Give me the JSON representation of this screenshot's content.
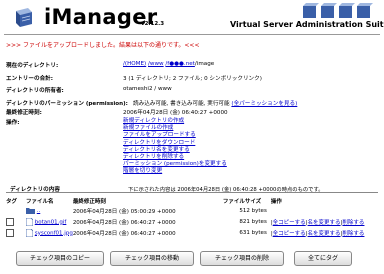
{
  "header": {
    "title": "iManager",
    "version": "v2.12.3",
    "suite": "Virtual Server Administration Suite"
  },
  "notice": ">>> ファイルをアップロードしました。結果は以下の通りです。<<<",
  "info": {
    "cwd_label": "現在のディレクトリ:",
    "cwd_link1": "/(HOME)",
    "cwd_link2": "/www",
    "cwd_link3": "/f●●●.net",
    "cwd_tail": "/image",
    "entries_label": "エントリーの合計:",
    "entries_value": "3 (1 ディレクトリ; 2 ファイル; 0 シンボリックリンク)",
    "owner_label": "ディレクトリの所有者:",
    "owner_value": "otameshi2 / www",
    "perm_label": "ディレクトリのパーミッション (permission):",
    "perm_value": "読み込み可能, 書き込み可能, 実行可能",
    "perm_link": "(全パーミッションを見る)",
    "modified_label": "最終修正時刻:",
    "modified_value": "2006年04月28日 (金) 06:40:27 +0000",
    "ops_label": "操作:"
  },
  "operations": [
    "新規ディレクトリの作成",
    "新規ファイルの作成",
    "ファイルをアップロードする",
    "ディレクトリをダウンロード",
    "ディレクトリ名を変更する",
    "ディレクトリを削除する",
    "パーミッション (permission)を変更する",
    "階層を切り変更"
  ],
  "dir_section": {
    "heading": "ディレクトリの内容",
    "note": "下に示された内容は 2006年04月28日 (金) 06:40:28 +0000の時点のものです。"
  },
  "table": {
    "headers": [
      "タグ",
      "ファイル名",
      "最終修正時刻",
      "ファイルサイズ",
      "操作"
    ],
    "rows": [
      {
        "name": "..",
        "date": "2006年04月28日 (金) 05:00:29 +0000",
        "size": "512 bytes",
        "ops": []
      },
      {
        "name": "botan01.gif",
        "date": "2006年04月28日 (金) 06:40:27 +0000",
        "size": "821 bytes",
        "ops": [
          "全コピーする",
          "名を変更する",
          "削除する"
        ]
      },
      {
        "name": "sysconf01.jpg",
        "date": "2006年04月28日 (金) 06:40:27 +0000",
        "size": "631 bytes",
        "ops": [
          "全コピーする",
          "名を変更する",
          "削除する"
        ]
      }
    ]
  },
  "buttons": {
    "copy": "チェック項目のコピー",
    "move": "チェック項目の移動",
    "delete": "チェック項目の削除",
    "tag_all": "全てにタグ"
  },
  "colors": {
    "notice": "#cc0000",
    "link": "#0000cc",
    "logo": "#3a5fa8"
  }
}
